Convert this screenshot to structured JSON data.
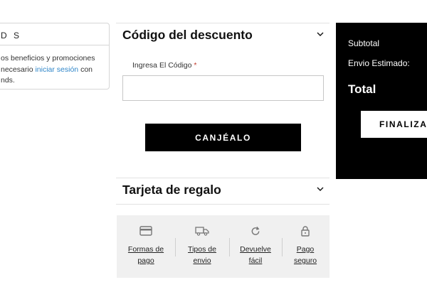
{
  "left_card": {
    "title": "D S",
    "text_before_link": "os beneficios y promociones necesario ",
    "link": "iniciar sesión",
    "text_after_link": " con nds."
  },
  "discount": {
    "title": "Código del descuento",
    "field_label": "Ingresa El Código",
    "required_mark": "*",
    "input_value": "",
    "button_label": "CANJÉALO"
  },
  "gift_card": {
    "title": "Tarjeta de regalo"
  },
  "trust_bar": {
    "items": [
      {
        "icon": "credit-card-icon",
        "label": "Formas de\npago"
      },
      {
        "icon": "truck-icon",
        "label": "Tipos de\nenvio"
      },
      {
        "icon": "refresh-icon",
        "label": "Devuelve\nfácil"
      },
      {
        "icon": "lock-icon",
        "label": "Pago\nseguro"
      }
    ]
  },
  "summary": {
    "subtotal_label": "Subtotal",
    "shipping_label": "Envio Estimado:",
    "total_label": "Total",
    "checkout_label": "FINALIZA"
  },
  "colors": {
    "link": "#2f86c9",
    "summary_bg": "#000000",
    "trust_bg": "#f0f0f0",
    "button_bg": "#000000"
  }
}
